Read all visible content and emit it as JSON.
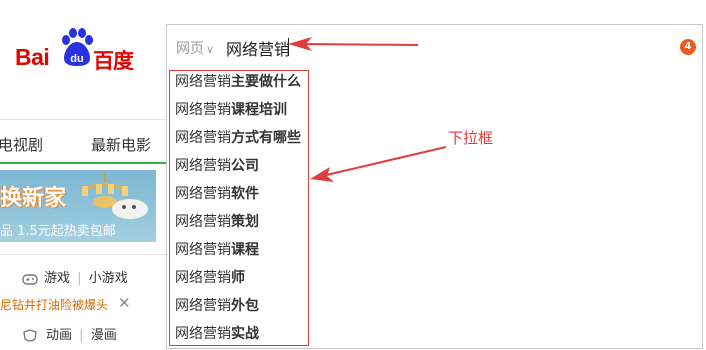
{
  "logo": {
    "latin": "Bai",
    "paw_text": "du",
    "chinese": "百度"
  },
  "left_nav": {
    "tv_label": "电视剧",
    "movie_label": "最新电影"
  },
  "banner": {
    "title": "换新家",
    "subtitle": "品 1.5元起热卖包邮"
  },
  "game_links": {
    "games": "游戏",
    "separator": "|",
    "mini_games": "小游戏"
  },
  "news": {
    "headline": "尼钻井打油险被爆头"
  },
  "anim_links": {
    "animation": "动画",
    "separator": "|",
    "manga": "漫画"
  },
  "search": {
    "scope": "网页",
    "query": "网络营销",
    "badge_count": "4"
  },
  "suggestions": [
    {
      "prefix": "网络营销",
      "suffix": "主要做什么"
    },
    {
      "prefix": "网络营销",
      "suffix": "课程培训"
    },
    {
      "prefix": "网络营销",
      "suffix": "方式有哪些"
    },
    {
      "prefix": "网络营销",
      "suffix": "公司"
    },
    {
      "prefix": "网络营销",
      "suffix": "软件"
    },
    {
      "prefix": "网络营销",
      "suffix": "策划"
    },
    {
      "prefix": "网络营销",
      "suffix": "课程"
    },
    {
      "prefix": "网络营销",
      "suffix": "师"
    },
    {
      "prefix": "网络营销",
      "suffix": "外包"
    },
    {
      "prefix": "网络营销",
      "suffix": "实战"
    }
  ],
  "annotation": {
    "label": "下拉框"
  },
  "colors": {
    "brand_red": "#e10602",
    "baidu_blue": "#2932e1",
    "annotation_red": "#e23b3b",
    "badge_orange": "#f05a22",
    "nav_green": "#38b03f"
  }
}
